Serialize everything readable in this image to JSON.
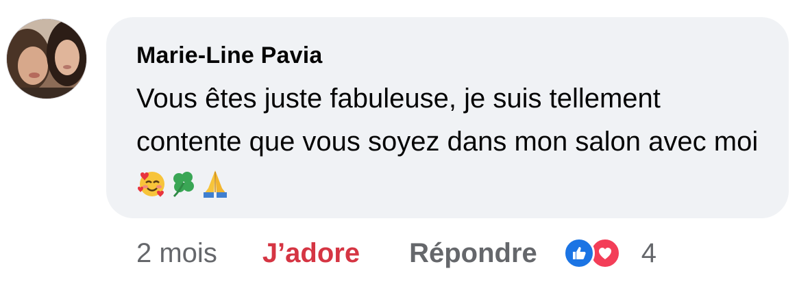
{
  "comment": {
    "author": "Marie-Line Pavia",
    "text": "Vous êtes juste fabuleuse, je suis tellement contente que vous soyez dans mon salon avec moi",
    "emojis": [
      "smiling-face-with-hearts",
      "shamrock",
      "folded-hands"
    ]
  },
  "actions": {
    "timestamp": "2 mois",
    "love_label": "J’adore",
    "reply_label": "Répondre",
    "reaction_count": "4",
    "reaction_icons": [
      "like-icon",
      "heart-icon"
    ]
  },
  "colors": {
    "bubble": "#f0f2f5",
    "love": "#d53543",
    "like": "#1b74e4",
    "heart": "#f33e58",
    "secondary_text": "#65676b"
  }
}
